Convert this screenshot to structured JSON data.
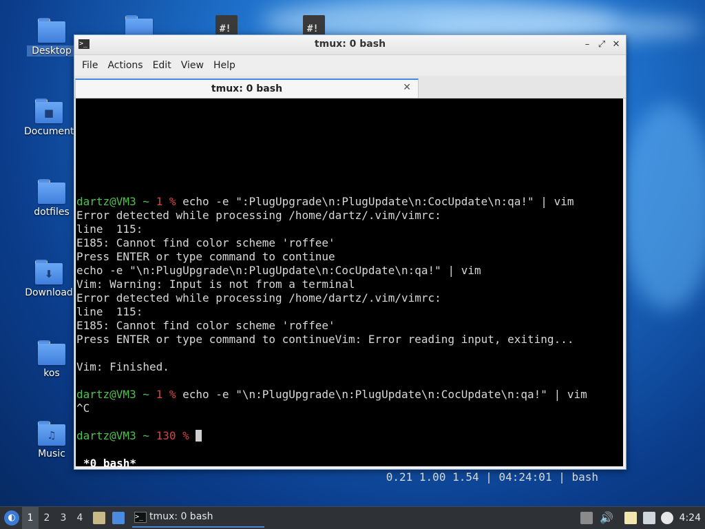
{
  "desktop": {
    "icons": [
      {
        "label": "Desktop",
        "glyph": ""
      },
      {
        "label": "Document",
        "glyph": "■"
      },
      {
        "label": "dotfiles",
        "glyph": ""
      },
      {
        "label": "Download",
        "glyph": "⬇"
      },
      {
        "label": "kos",
        "glyph": ""
      },
      {
        "label": "Music",
        "glyph": "♫"
      }
    ]
  },
  "window": {
    "title": "tmux: 0 bash",
    "icon": "terminal-icon",
    "controls": {
      "minimize": "–",
      "maximize": "⤢",
      "close": "✕"
    },
    "menu": [
      "File",
      "Actions",
      "Edit",
      "View",
      "Help"
    ],
    "tab": {
      "label": "tmux: 0 bash",
      "close": "✕"
    }
  },
  "terminal": {
    "prompt1": {
      "user": "dartz@VM3 ~ ",
      "code": "1 % ",
      "cmd": "echo -e \":PlugUpgrade\\n:PlugUpdate\\n:CocUpdate\\n:qa!\" | vim"
    },
    "output": [
      "Error detected while processing /home/dartz/.vim/vimrc:",
      "line  115:",
      "E185: Cannot find color scheme 'roffee'",
      "Press ENTER or type command to continue",
      "echo -e \"\\n:PlugUpgrade\\n:PlugUpdate\\n:CocUpdate\\n:qa!\" | vim",
      "Vim: Warning: Input is not from a terminal",
      "Error detected while processing /home/dartz/.vim/vimrc:",
      "line  115:",
      "E185: Cannot find color scheme 'roffee'",
      "Press ENTER or type command to continueVim: Error reading input, exiting...",
      "",
      "Vim: Finished.",
      ""
    ],
    "prompt2": {
      "user": "dartz@VM3 ~ ",
      "code": "1 % ",
      "cmd": "echo -e \"\\n:PlugUpgrade\\n:PlugUpdate\\n:CocUpdate\\n:qa!\" | vim"
    },
    "interrupt": "^C",
    "prompt3": {
      "user": "dartz@VM3 ~ ",
      "code": "130 % "
    },
    "status_left": "*0 bash*",
    "status_right": "0.21 1.00 1.54 | 04:24:01 | bash"
  },
  "taskbar": {
    "workspaces": [
      "1",
      "2",
      "3",
      "4"
    ],
    "active_workspace": "1",
    "task_label": "tmux: 0 bash",
    "clock": "4:24"
  },
  "colors": {
    "prompt_user": "#4cc34c",
    "prompt_code": "#d64545",
    "accent": "#4a86d8"
  }
}
